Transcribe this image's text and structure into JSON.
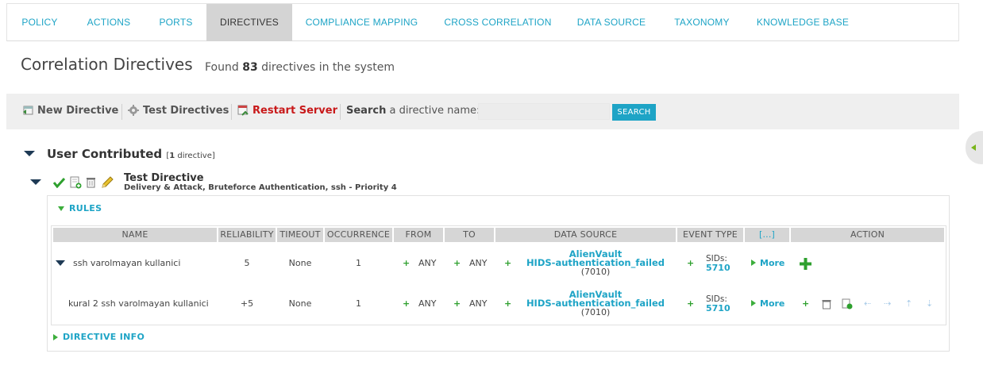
{
  "nav": {
    "tabs": [
      {
        "label": "POLICY"
      },
      {
        "label": "ACTIONS"
      },
      {
        "label": "PORTS"
      },
      {
        "label": "DIRECTIVES"
      },
      {
        "label": "COMPLIANCE MAPPING"
      },
      {
        "label": "CROSS CORRELATION"
      },
      {
        "label": "DATA SOURCE"
      },
      {
        "label": "TAXONOMY"
      },
      {
        "label": "KNOWLEDGE BASE"
      }
    ],
    "active": "DIRECTIVES"
  },
  "header": {
    "title": "Correlation Directives",
    "found_prefix": "Found",
    "found_count": "83",
    "found_suffix": "directives in the system"
  },
  "toolbar": {
    "new_directive": "New Directive",
    "test_directives": "Test Directives",
    "restart_server": "Restart Server",
    "search_bold": "Search",
    "search_rest": "a directive name:",
    "search_value": "",
    "search_button": "SEARCH"
  },
  "group": {
    "title": "User Contributed",
    "count_open": "[",
    "count": "1",
    "count_close": "directive]"
  },
  "directive": {
    "name": "Test Directive",
    "subtitle": "Delivery & Attack, Bruteforce Authentication, ssh - Priority 4"
  },
  "rules_section": {
    "toggle_label": "RULES",
    "columns": [
      "NAME",
      "RELIABILITY",
      "TIMEOUT",
      "OCCURRENCE",
      "FROM",
      "TO",
      "DATA SOURCE",
      "EVENT TYPE",
      "[...]",
      "ACTION"
    ],
    "rows": [
      {
        "name": "ssh varolmayan kullanici",
        "reliability": "5",
        "timeout": "None",
        "occurrence": "1",
        "from": "ANY",
        "to": "ANY",
        "ds_line1": "AlienVault",
        "ds_line2": "HIDS-authentication_failed",
        "ds_id": "(7010)",
        "sids_label": "SIDs:",
        "sids_value": "5710",
        "more": "More",
        "plus": "+"
      },
      {
        "name": "kural 2 ssh varolmayan kullanici",
        "reliability": "+5",
        "timeout": "None",
        "occurrence": "1",
        "from": "ANY",
        "to": "ANY",
        "ds_line1": "AlienVault",
        "ds_line2": "HIDS-authentication_failed",
        "ds_id": "(7010)",
        "sids_label": "SIDs:",
        "sids_value": "5710",
        "more": "More",
        "plus": "+"
      }
    ]
  },
  "directive_info": {
    "label": "DIRECTIVE INFO"
  },
  "colors": {
    "accent": "#1ea4c6",
    "active_tab": "#d4d4d4",
    "danger": "#c8191a",
    "green": "#2ea02e"
  }
}
